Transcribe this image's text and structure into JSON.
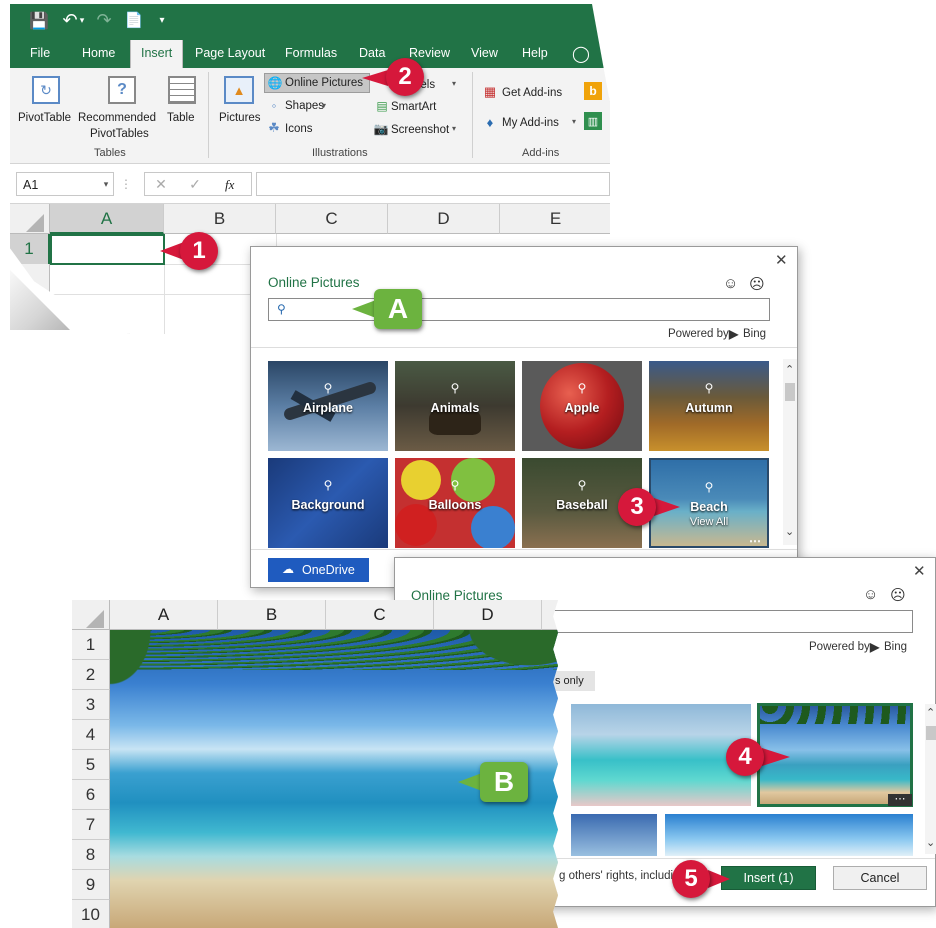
{
  "excel": {
    "tabs": [
      "File",
      "Home",
      "Insert",
      "Page Layout",
      "Formulas",
      "Data",
      "Review",
      "View",
      "Help"
    ],
    "active_tab": "Insert",
    "tables_group": {
      "pivottable": "PivotTable",
      "recommended_line1": "Recommended",
      "recommended_line2": "PivotTables",
      "table": "Table",
      "label": "Tables"
    },
    "illustrations_group": {
      "pictures": "Pictures",
      "online_pictures": "Online Pictures",
      "shapes": "Shapes",
      "icons": "Icons",
      "models": "dels",
      "smartart": "SmartArt",
      "screenshot": "Screenshot",
      "label": "Illustrations"
    },
    "addins_group": {
      "get_addins": "Get Add-ins",
      "my_addins": "My Add-ins",
      "label": "Add-ins"
    },
    "name_box": "A1",
    "fx": "fx",
    "columns": [
      "A",
      "B",
      "C",
      "D",
      "E"
    ],
    "rows": [
      "1"
    ]
  },
  "dialog1": {
    "title": "Online Pictures",
    "search_placeholder": "",
    "powered_by": "Powered by",
    "bing": "Bing",
    "tiles": [
      {
        "label": "Airplane"
      },
      {
        "label": "Animals"
      },
      {
        "label": "Apple"
      },
      {
        "label": "Autumn"
      },
      {
        "label": "Background"
      },
      {
        "label": "Balloons"
      },
      {
        "label": "Baseball"
      },
      {
        "label": "Beach",
        "sub": "View All"
      }
    ],
    "onedrive": "OneDrive"
  },
  "dialog2": {
    "title": "Online Pictures",
    "powered_by": "Powered by",
    "bing": "Bing",
    "filter_chip": "s only",
    "license_text": "g others' rights, includi",
    "insert_label": "Insert (1)",
    "cancel_label": "Cancel"
  },
  "excel2": {
    "columns": [
      "A",
      "B",
      "C",
      "D"
    ],
    "rows": [
      "1",
      "2",
      "3",
      "4",
      "5",
      "6",
      "7",
      "8",
      "9",
      "10"
    ]
  },
  "callouts": {
    "one": "1",
    "two": "2",
    "three": "3",
    "four": "4",
    "five": "5",
    "a": "A",
    "b": "B"
  },
  "colors": {
    "excel_green": "#217346",
    "callout_red": "#d6183b",
    "callout_green": "#6cb33f",
    "onedrive_blue": "#1f5bbf"
  }
}
